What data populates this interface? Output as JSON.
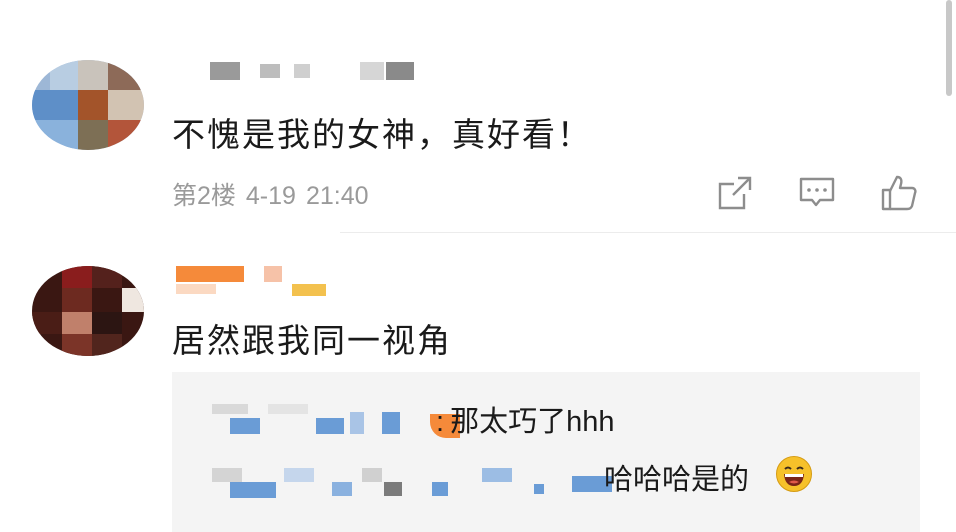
{
  "comment1": {
    "text": "不愧是我的女神，真好看！",
    "floor": "第2楼",
    "date": "4-19",
    "time": "21:40"
  },
  "comment2": {
    "text": "居然跟我同一视角",
    "replies": [
      {
        "separator": ":",
        "text": "那太巧了hhh"
      },
      {
        "text": "哈哈哈是的"
      }
    ]
  },
  "icons": [
    "share-icon",
    "reply-icon",
    "like-icon",
    "laughing-emoji-icon"
  ],
  "colors": {
    "meta_gray": "#9a9a9a",
    "reply_bg": "#f4f4f4",
    "blur_blue": "#6a9cd6",
    "blur_orange": "#f58a3a"
  }
}
